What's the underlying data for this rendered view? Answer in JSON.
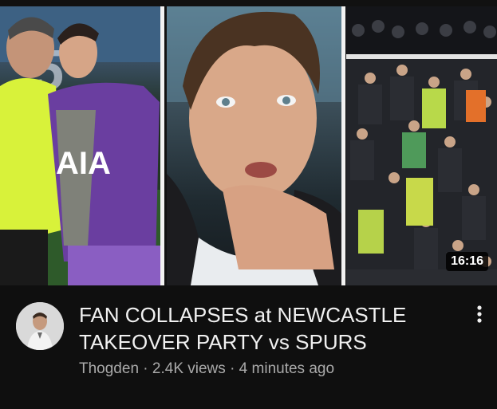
{
  "video": {
    "duration": "16:16",
    "title_line1": "FAN COLLAPSES at NEWCASTLE",
    "title_line2": "TAKEOVER PARTY vs SPURS",
    "channel": "Thogden",
    "views": "2.4K views",
    "age": "4 minutes ago",
    "separator": "·"
  },
  "thumbnail": {
    "shirt_text": "AIA",
    "board_text": "5"
  },
  "icons": {
    "more": "more-vert-icon",
    "avatar": "channel-avatar"
  }
}
